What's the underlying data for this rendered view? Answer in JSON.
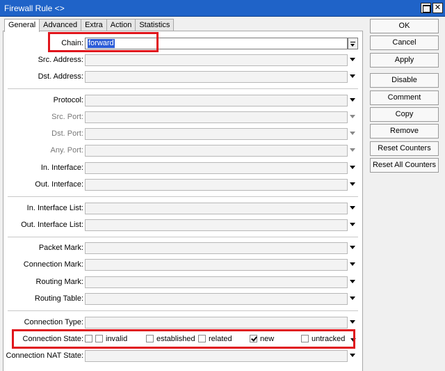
{
  "window": {
    "title": "Firewall Rule <>"
  },
  "tabs": [
    "General",
    "Advanced",
    "Extra",
    "Action",
    "Statistics"
  ],
  "fields": {
    "chain": {
      "label": "Chain:",
      "value": "forward"
    },
    "src_address": "Src. Address:",
    "dst_address": "Dst. Address:",
    "protocol": "Protocol:",
    "src_port": "Src. Port:",
    "dst_port": "Dst. Port:",
    "any_port": "Any. Port:",
    "in_interface": "In. Interface:",
    "out_interface": "Out. Interface:",
    "in_interface_list": "In. Interface List:",
    "out_interface_list": "Out. Interface List:",
    "packet_mark": "Packet Mark:",
    "connection_mark": "Connection Mark:",
    "routing_mark": "Routing Mark:",
    "routing_table": "Routing Table:",
    "connection_type": "Connection Type:",
    "connection_state": {
      "label": "Connection State:",
      "options": [
        {
          "label": "invalid",
          "checked": false
        },
        {
          "label": "established",
          "checked": false
        },
        {
          "label": "related",
          "checked": false
        },
        {
          "label": "new",
          "checked": true
        },
        {
          "label": "untracked",
          "checked": false
        }
      ]
    },
    "connection_nat_state": "Connection NAT State:"
  },
  "buttons": {
    "ok": "OK",
    "cancel": "Cancel",
    "apply": "Apply",
    "disable": "Disable",
    "comment": "Comment",
    "copy": "Copy",
    "remove": "Remove",
    "reset_counters": "Reset Counters",
    "reset_all_counters": "Reset All Counters"
  },
  "colors": {
    "titlebar": "#1f63c8",
    "highlight": "#e0151c",
    "selection": "#2a5bd7"
  }
}
